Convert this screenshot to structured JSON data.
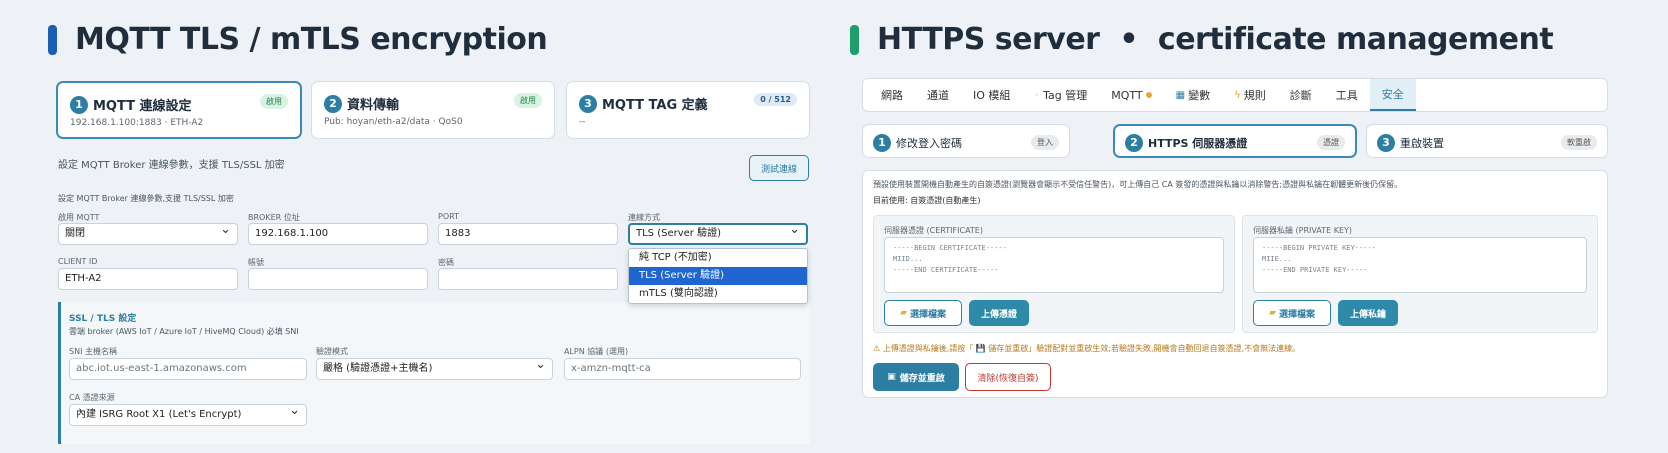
{
  "left": {
    "title": "MQTT TLS / mTLS encryption",
    "accent": "#1a5fb4",
    "steps": [
      {
        "num": "1",
        "title": "MQTT 連線設定",
        "sub": "192.168.1.100:1883 · ETH-A2",
        "badge": "啟用"
      },
      {
        "num": "2",
        "title": "資料傳輸",
        "sub": "Pub: hoyan/eth-a2/data · QoS0",
        "badge": "啟用"
      },
      {
        "num": "3",
        "title": "MQTT TAG 定義",
        "sub": "--",
        "badge": "0 / 512"
      }
    ],
    "desc": "設定 MQTT Broker 連線參數，支援 TLS/SSL 加密",
    "test_button": "測試連線",
    "desc2": "設定 MQTT Broker 連線參數,支援 TLS/SSL 加密",
    "fields": {
      "enable": {
        "label": "啟用 MQTT",
        "value": "關閉"
      },
      "broker": {
        "label": "BROKER 位址",
        "value": "192.168.1.100"
      },
      "port": {
        "label": "PORT",
        "value": "1883"
      },
      "conn": {
        "label": "連線方式",
        "value": "TLS (Server 驗證)"
      },
      "client_id": {
        "label": "CLIENT ID",
        "value": "ETH-A2"
      },
      "account": {
        "label": "帳號",
        "value": ""
      },
      "password": {
        "label": "密碼",
        "value": ""
      }
    },
    "dropdown_options": [
      "純 TCP (不加密)",
      "TLS (Server 驗證)",
      "mTLS (雙向認證)"
    ],
    "ssl": {
      "title": "SSL / TLS 設定",
      "note": "雲端 broker (AWS IoT / Azure IoT / HiveMQ Cloud) 必填 SNI",
      "sni_label": "SNI 主機名稱",
      "sni_placeholder": "abc.iot.us-east-1.amazonaws.com",
      "verify_label": "驗證模式",
      "verify_value": "嚴格 (驗證憑證+主機名)",
      "alpn_label": "ALPN 協議 (選用)",
      "alpn_placeholder": "x-amzn-mqtt-ca",
      "ca_label": "CA 憑證來源",
      "ca_value": "內建 ISRG Root X1 (Let's Encrypt)"
    }
  },
  "right": {
    "title": "HTTPS server  •  certificate management",
    "accent": "#1f9e6b",
    "tabs": [
      "網路",
      "通道",
      "IO 模組",
      "Tag 管理",
      "MQTT",
      "變數",
      "規則",
      "診斷",
      "工具",
      "安全"
    ],
    "steps": [
      {
        "num": "1",
        "title": "修改登入密碼",
        "badge": "登入"
      },
      {
        "num": "2",
        "title": "HTTPS 伺服器憑證",
        "badge": "憑證"
      },
      {
        "num": "3",
        "title": "重啟裝置",
        "badge": "軟重啟"
      }
    ],
    "info": "預設使用裝置開機自動產生的自簽憑證(瀏覽器會顯示不受信任警告)，可上傳自己 CA 簽發的憑證與私鑰以消除警告;憑證與私鑰在韌體更新後仍保留。",
    "current": "目前使用: 自簽憑證(自動產生)",
    "cert": {
      "label": "伺服器憑證 (CERTIFICATE)",
      "placeholder": "-----BEGIN CERTIFICATE-----\nMIID...\n-----END CERTIFICATE-----",
      "choose": "選擇檔案",
      "upload": "上傳憑證"
    },
    "key": {
      "label": "伺服器私鑰 (PRIVATE KEY)",
      "placeholder": "-----BEGIN PRIVATE KEY-----\nMIIE...\n-----END PRIVATE KEY-----",
      "choose": "選擇檔案",
      "upload": "上傳私鑰"
    },
    "warning": "⚠ 上傳憑證與私鑰後,請按「 💾 儲存並重啟」驗證配對並重啟生效;若驗證失敗,開機會自動回退自簽憑證,不會無法連線。",
    "save": "儲存並重啟",
    "clear": "清除(恢復自簽)"
  },
  "colors": {
    "primary": "#2d7ea3",
    "danger": "#c0392b",
    "warning": "#b7791f"
  }
}
